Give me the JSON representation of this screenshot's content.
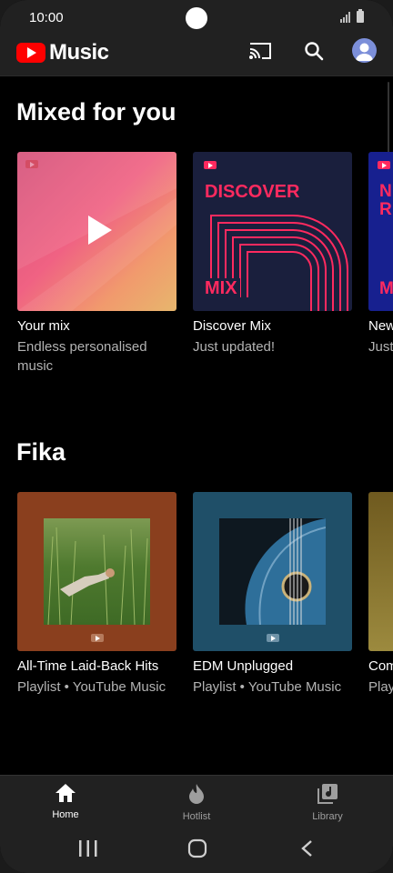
{
  "status": {
    "time": "10:00"
  },
  "app": {
    "title": "Music"
  },
  "sections": [
    {
      "title": "Mixed for you",
      "cards": [
        {
          "title": "Your mix",
          "subtitle": "Endless personalised music"
        },
        {
          "title": "Discover Mix",
          "subtitle": "Just updated!",
          "art_text_top": "DISCOVER",
          "art_text_bottom": "MIX"
        },
        {
          "title": "New",
          "subtitle": "Just",
          "art_text_top": "N\nR",
          "art_text_bottom": "M"
        }
      ]
    },
    {
      "title": "Fika",
      "cards": [
        {
          "title": "All-Time Laid-Back Hits",
          "subtitle": "Playlist • YouTube Music"
        },
        {
          "title": "EDM Unplugged",
          "subtitle": "Playlist • YouTube Music"
        },
        {
          "title": "Com",
          "subtitle": "Play"
        }
      ]
    }
  ],
  "nav": {
    "items": [
      {
        "label": "Home",
        "icon": "home-icon",
        "active": true
      },
      {
        "label": "Hotlist",
        "icon": "flame-icon",
        "active": false
      },
      {
        "label": "Library",
        "icon": "library-icon",
        "active": false
      }
    ]
  },
  "colors": {
    "accent": "#ff0000",
    "bar": "#212121",
    "background": "#000000",
    "discover_pink": "#ff2a5f"
  }
}
